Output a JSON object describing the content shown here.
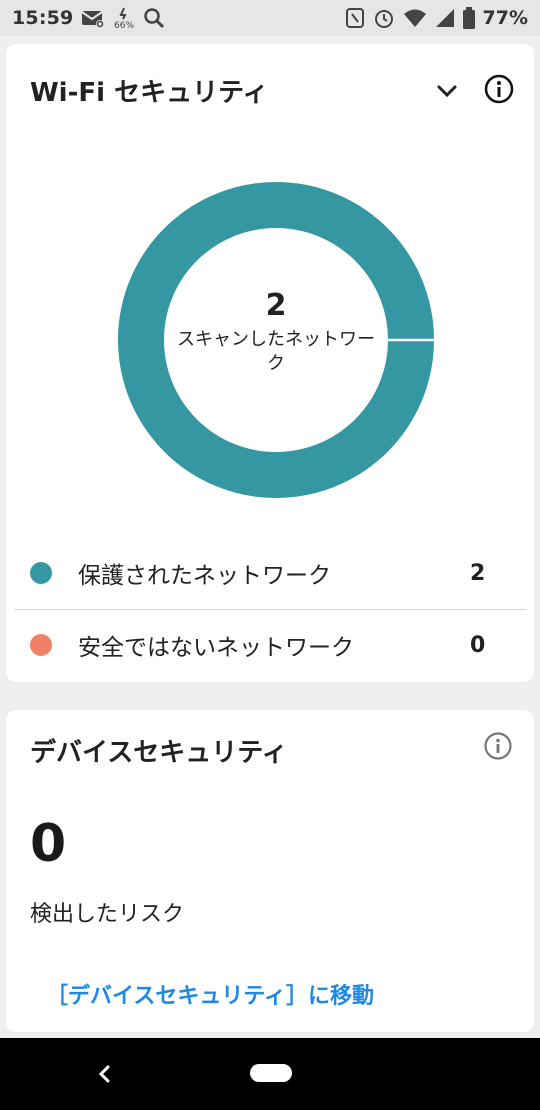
{
  "status_bar": {
    "time": "15:59",
    "battery": "77%",
    "icons_left": [
      "mail-icon",
      "cpu-icon",
      "search-icon"
    ],
    "icons_right": [
      "nfc-icon",
      "alarm-icon",
      "wifi-icon",
      "signal-icon",
      "battery-icon"
    ]
  },
  "wifi_card": {
    "title": "Wi-Fi セキュリティ",
    "chevron": "chevron-down-icon",
    "info": "info-icon",
    "donut": {
      "count": "2",
      "label": "スキャンしたネットワーク"
    },
    "legend": [
      {
        "label": "保護されたネットワーク",
        "value": "2",
        "color": "#3497a2"
      },
      {
        "label": "安全ではないネットワーク",
        "value": "0",
        "color": "#f08066"
      }
    ]
  },
  "device_card": {
    "title": "デバイスセキュリティ",
    "info": "info-icon",
    "risk_count": "0",
    "risk_label": "検出したリスク",
    "link": "［デバイスセキュリティ］に移動"
  },
  "nav_bar": {
    "back": "back-icon",
    "home": "home-pill"
  },
  "chart_data": {
    "type": "pie",
    "categories": [
      "保護されたネットワーク",
      "安全ではないネットワーク"
    ],
    "values": [
      2,
      0
    ],
    "colors": [
      "#3497a2",
      "#f08066"
    ],
    "title": "",
    "center_text": "2 スキャンしたネットワーク"
  }
}
